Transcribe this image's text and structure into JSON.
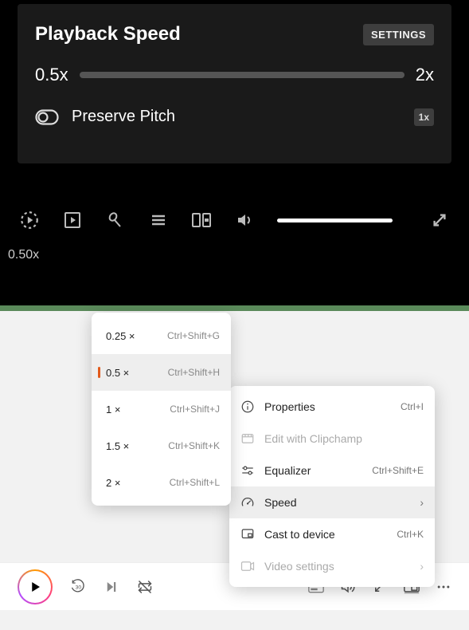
{
  "panel": {
    "title": "Playback Speed",
    "settings_label": "SETTINGS",
    "min_label": "0.5x",
    "max_label": "2x",
    "pitch_label": "Preserve Pitch",
    "reset_label": "1x"
  },
  "toolbar": {
    "speed_readout": "0.50x"
  },
  "speed_menu": {
    "items": [
      {
        "val": "0.25 ×",
        "sc": "Ctrl+Shift+G",
        "sel": false
      },
      {
        "val": "0.5 ×",
        "sc": "Ctrl+Shift+H",
        "sel": true
      },
      {
        "val": "1 ×",
        "sc": "Ctrl+Shift+J",
        "sel": false
      },
      {
        "val": "1.5 ×",
        "sc": "Ctrl+Shift+K",
        "sel": false
      },
      {
        "val": "2 ×",
        "sc": "Ctrl+Shift+L",
        "sel": false
      }
    ]
  },
  "ctx_menu": {
    "items": [
      {
        "icon": "info",
        "label": "Properties",
        "sc": "Ctrl+I",
        "disabled": false,
        "hov": false,
        "chev": false
      },
      {
        "icon": "clipchamp",
        "label": "Edit with Clipchamp",
        "sc": "",
        "disabled": true,
        "hov": false,
        "chev": false
      },
      {
        "icon": "equalizer",
        "label": "Equalizer",
        "sc": "Ctrl+Shift+E",
        "disabled": false,
        "hov": false,
        "chev": false
      },
      {
        "icon": "speed",
        "label": "Speed",
        "sc": "",
        "disabled": false,
        "hov": true,
        "chev": true
      },
      {
        "icon": "cast",
        "label": "Cast to device",
        "sc": "Ctrl+K",
        "disabled": false,
        "hov": false,
        "chev": false
      },
      {
        "icon": "video",
        "label": "Video settings",
        "sc": "",
        "disabled": true,
        "hov": false,
        "chev": true
      }
    ]
  }
}
